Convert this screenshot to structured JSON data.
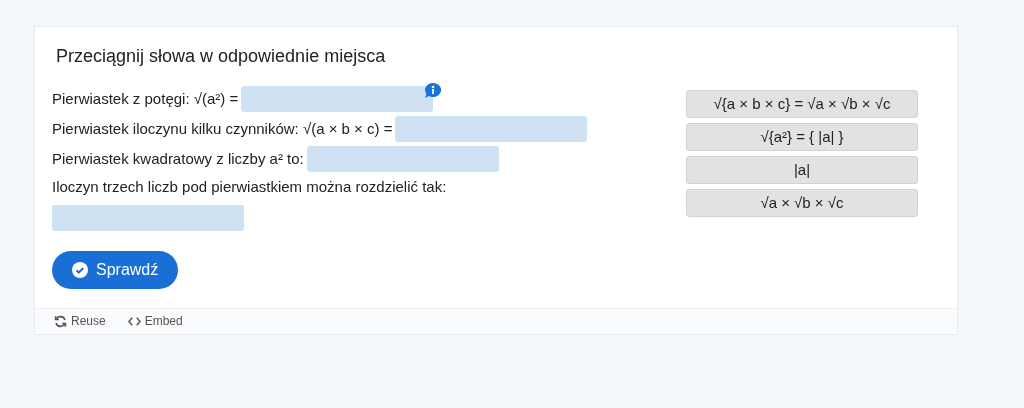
{
  "title": "Przeciągnij słowa w odpowiednie miejsca",
  "questions": [
    {
      "prompt": "Pierwiastek z potęgi: √(a²) =",
      "info": true
    },
    {
      "prompt": "Pierwiastek iloczynu kilku czynników: √(a × b × c) =",
      "info": false
    },
    {
      "prompt": "Pierwiastek kwadratowy z liczby a² to:",
      "info": false
    },
    {
      "prompt": "Iloczyn trzech liczb pod pierwiastkiem można rozdzielić tak:",
      "info": false
    }
  ],
  "words": [
    "√{a × b × c} = √a × √b × √c",
    "√{a²} = { |a| }",
    "|a|",
    "√a × √b × √c"
  ],
  "check_button": "Sprawdź",
  "footer": [
    {
      "kind": "reuse",
      "label": "Reuse"
    },
    {
      "kind": "embed",
      "label": "Embed"
    }
  ]
}
